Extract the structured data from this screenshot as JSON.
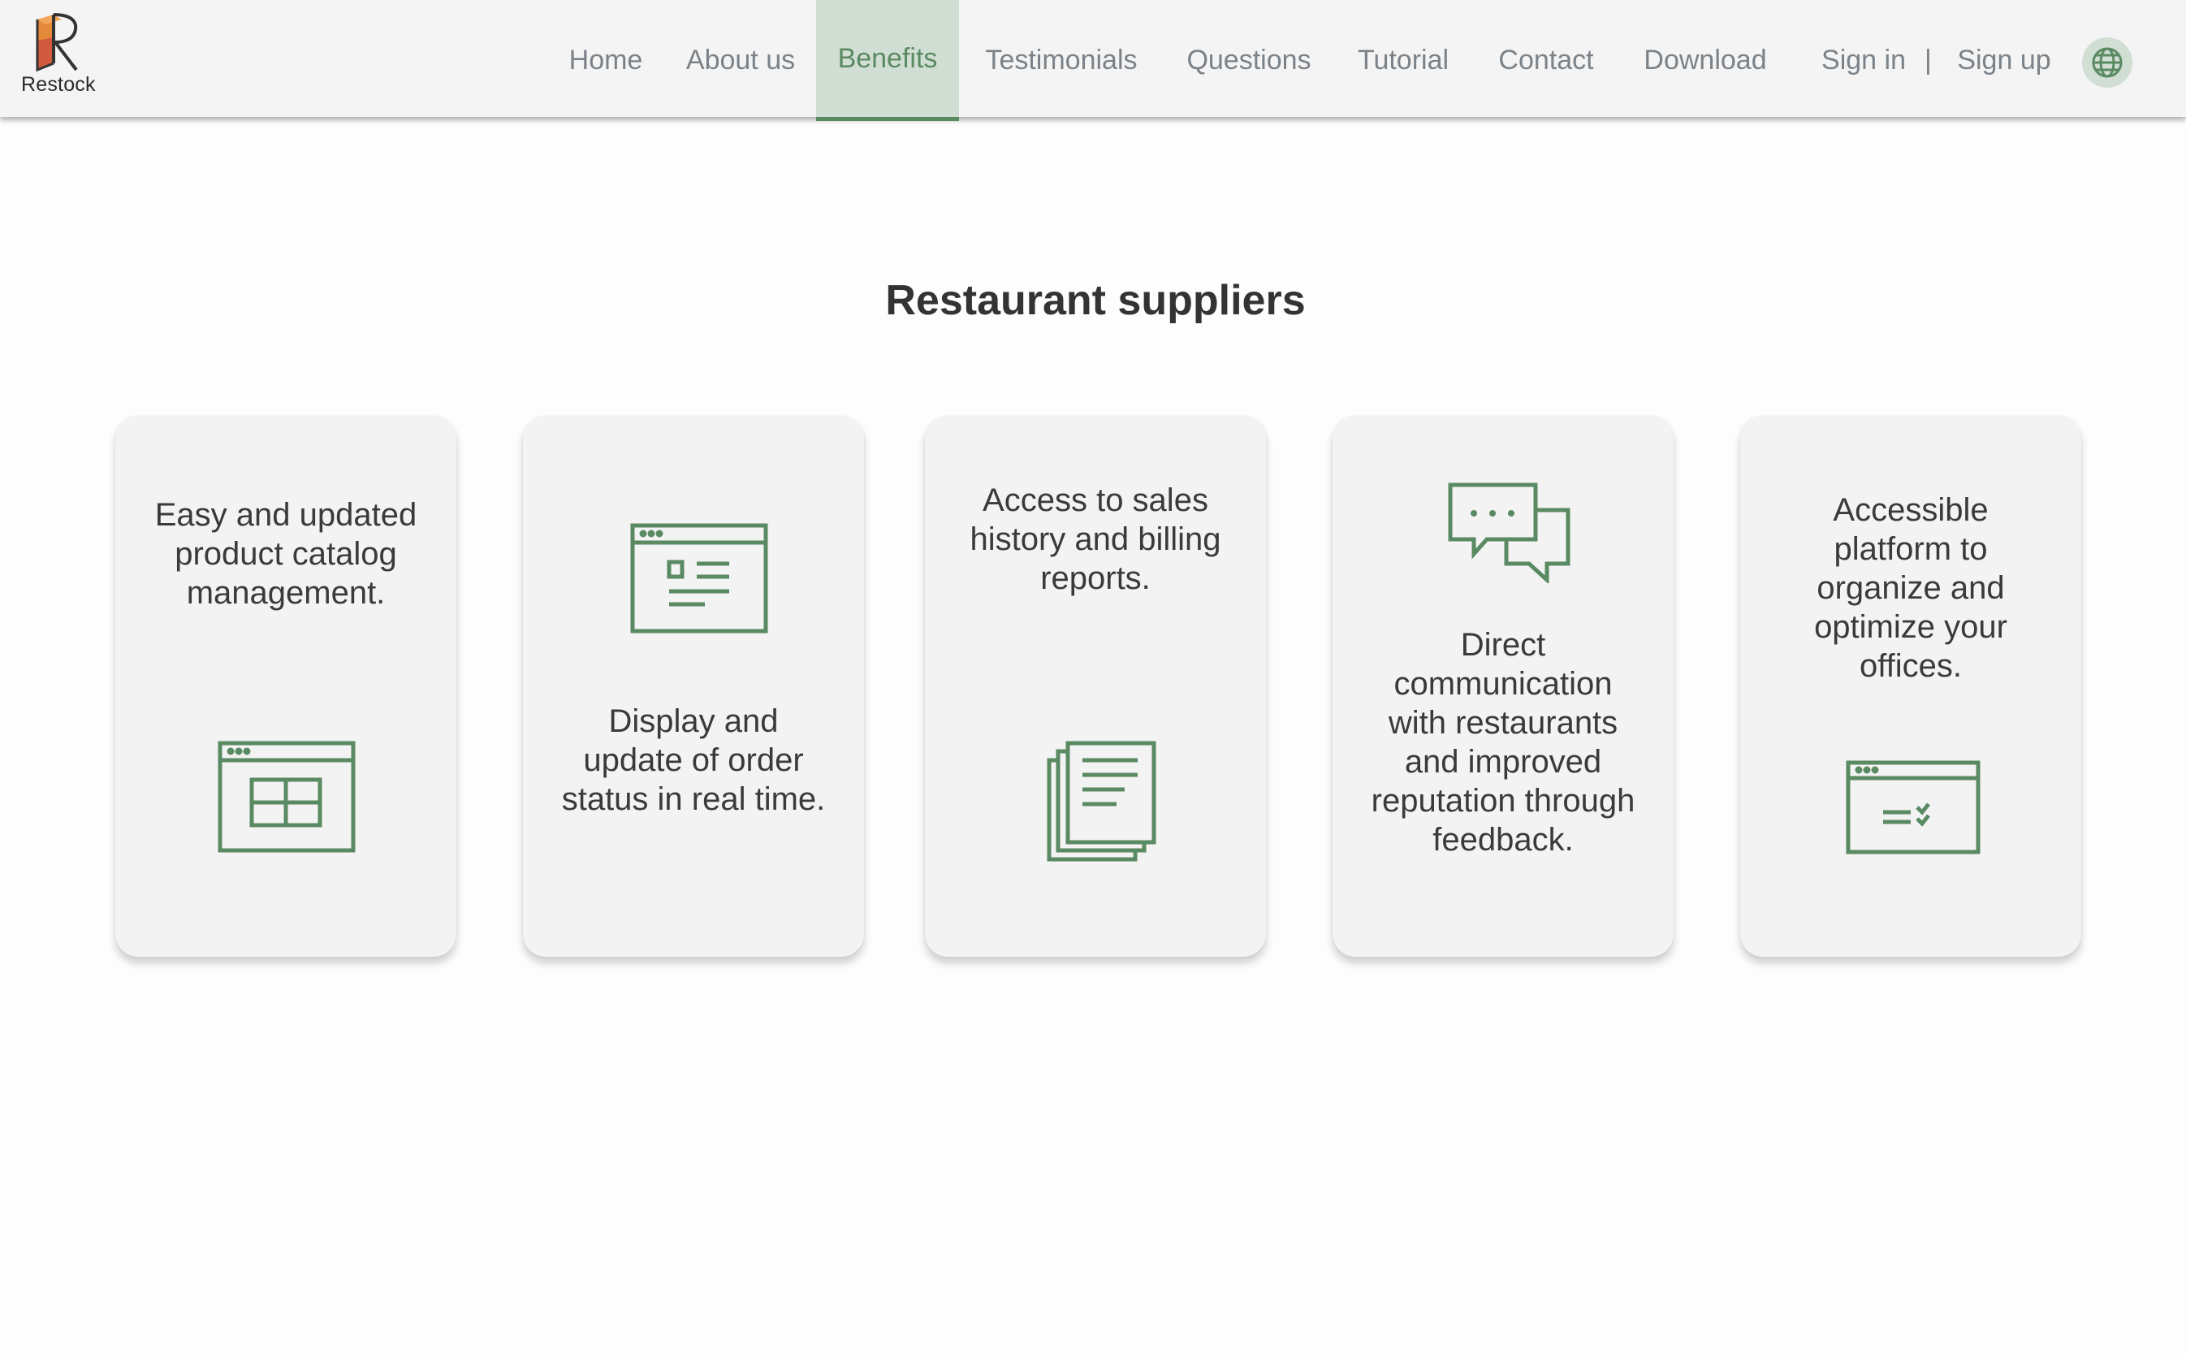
{
  "brand": {
    "name": "Restock",
    "accent": "#5a8a62",
    "accent_bg": "#d1ded4"
  },
  "nav": {
    "items": [
      {
        "label": "Home",
        "active": false
      },
      {
        "label": "About us",
        "active": false
      },
      {
        "label": "Benefits",
        "active": true
      },
      {
        "label": "Testimonials",
        "active": false
      },
      {
        "label": "Questions",
        "active": false
      },
      {
        "label": "Tutorial",
        "active": false
      },
      {
        "label": "Contact",
        "active": false
      },
      {
        "label": "Download",
        "active": false
      }
    ],
    "sign_in": "Sign in",
    "separator": "|",
    "sign_up": "Sign up",
    "language_icon": "globe-icon"
  },
  "section": {
    "title": "Restaurant suppliers"
  },
  "cards": [
    {
      "text": "Easy and updated product catalog management.",
      "icon": "catalog-table-icon"
    },
    {
      "text": "Display and update of order status in real time.",
      "icon": "order-status-window-icon"
    },
    {
      "text": "Access to sales history and billing reports.",
      "icon": "documents-stack-icon"
    },
    {
      "text": "Direct communication with restaurants and improved reputation through feedback.",
      "icon": "chat-bubbles-icon"
    },
    {
      "text": "Accessible platform to organize and optimize your offices.",
      "icon": "checklist-window-icon"
    }
  ]
}
